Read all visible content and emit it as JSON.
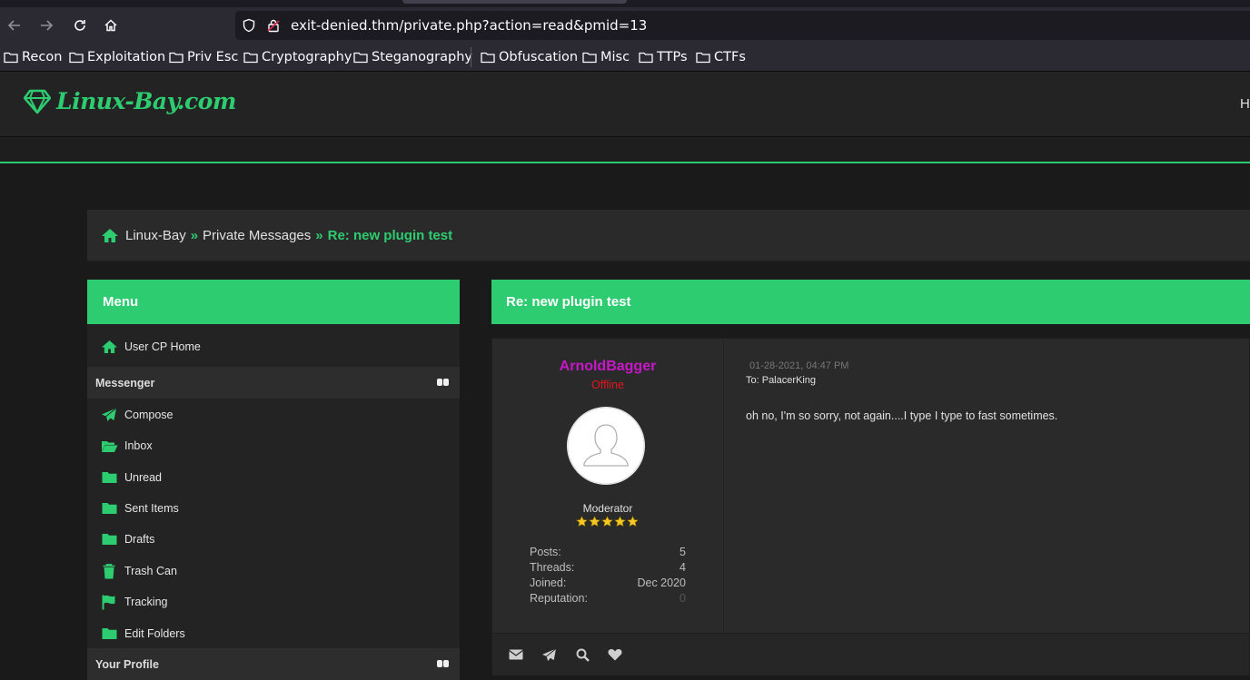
{
  "browser": {
    "url": "exit-denied.thm/private.php?action=read&pmid=13",
    "bookmarks": [
      {
        "label": "Recon"
      },
      {
        "label": "Exploitation"
      },
      {
        "label": "Priv Esc"
      },
      {
        "label": "Cryptography"
      },
      {
        "label": "Steganography"
      },
      {
        "label": "Obfuscation"
      },
      {
        "label": "Misc"
      },
      {
        "label": "TTPs"
      },
      {
        "label": "CTFs"
      }
    ]
  },
  "site": {
    "logo": "Linux-Bay.com",
    "header_right": "H"
  },
  "breadcrumb": {
    "items": [
      "Linux-Bay",
      "Private Messages"
    ],
    "current": "Re: new plugin test",
    "separator": "»"
  },
  "menu": {
    "title": "Menu",
    "home": {
      "label": "User CP Home",
      "icon": "home-icon"
    },
    "messenger": {
      "label": "Messenger",
      "items": [
        {
          "label": "Compose",
          "icon": "paper-plane-icon"
        },
        {
          "label": "Inbox",
          "icon": "folder-open-icon"
        },
        {
          "label": "Unread",
          "icon": "folder-icon"
        },
        {
          "label": "Sent Items",
          "icon": "folder-icon"
        },
        {
          "label": "Drafts",
          "icon": "folder-icon"
        },
        {
          "label": "Trash Can",
          "icon": "trash-icon"
        },
        {
          "label": "Tracking",
          "icon": "flag-icon"
        },
        {
          "label": "Edit Folders",
          "icon": "folder-icon"
        }
      ]
    },
    "profile": {
      "label": "Your Profile"
    }
  },
  "message": {
    "subject": "Re: new plugin test",
    "author": {
      "name": "ArnoldBagger",
      "status": "Offline",
      "role": "Moderator",
      "stars": 5,
      "stats": [
        {
          "label": "Posts:",
          "value": "5"
        },
        {
          "label": "Threads:",
          "value": "4"
        },
        {
          "label": "Joined:",
          "value": "Dec 2020"
        },
        {
          "label": "Reputation:",
          "value": "0"
        }
      ]
    },
    "date": "01-28-2021, 04:47 PM",
    "to": "To: PalacerKing",
    "body": "oh no, I'm so sorry, not again....I type I type to fast sometimes.",
    "footer_icons": [
      "envelope-icon",
      "paper-plane-icon",
      "search-icon",
      "heart-icon"
    ]
  },
  "colors": {
    "accent": "#2ecc71",
    "author_name": "#c817c8",
    "offline": "#e0161c",
    "background": "#1a1a1a"
  }
}
